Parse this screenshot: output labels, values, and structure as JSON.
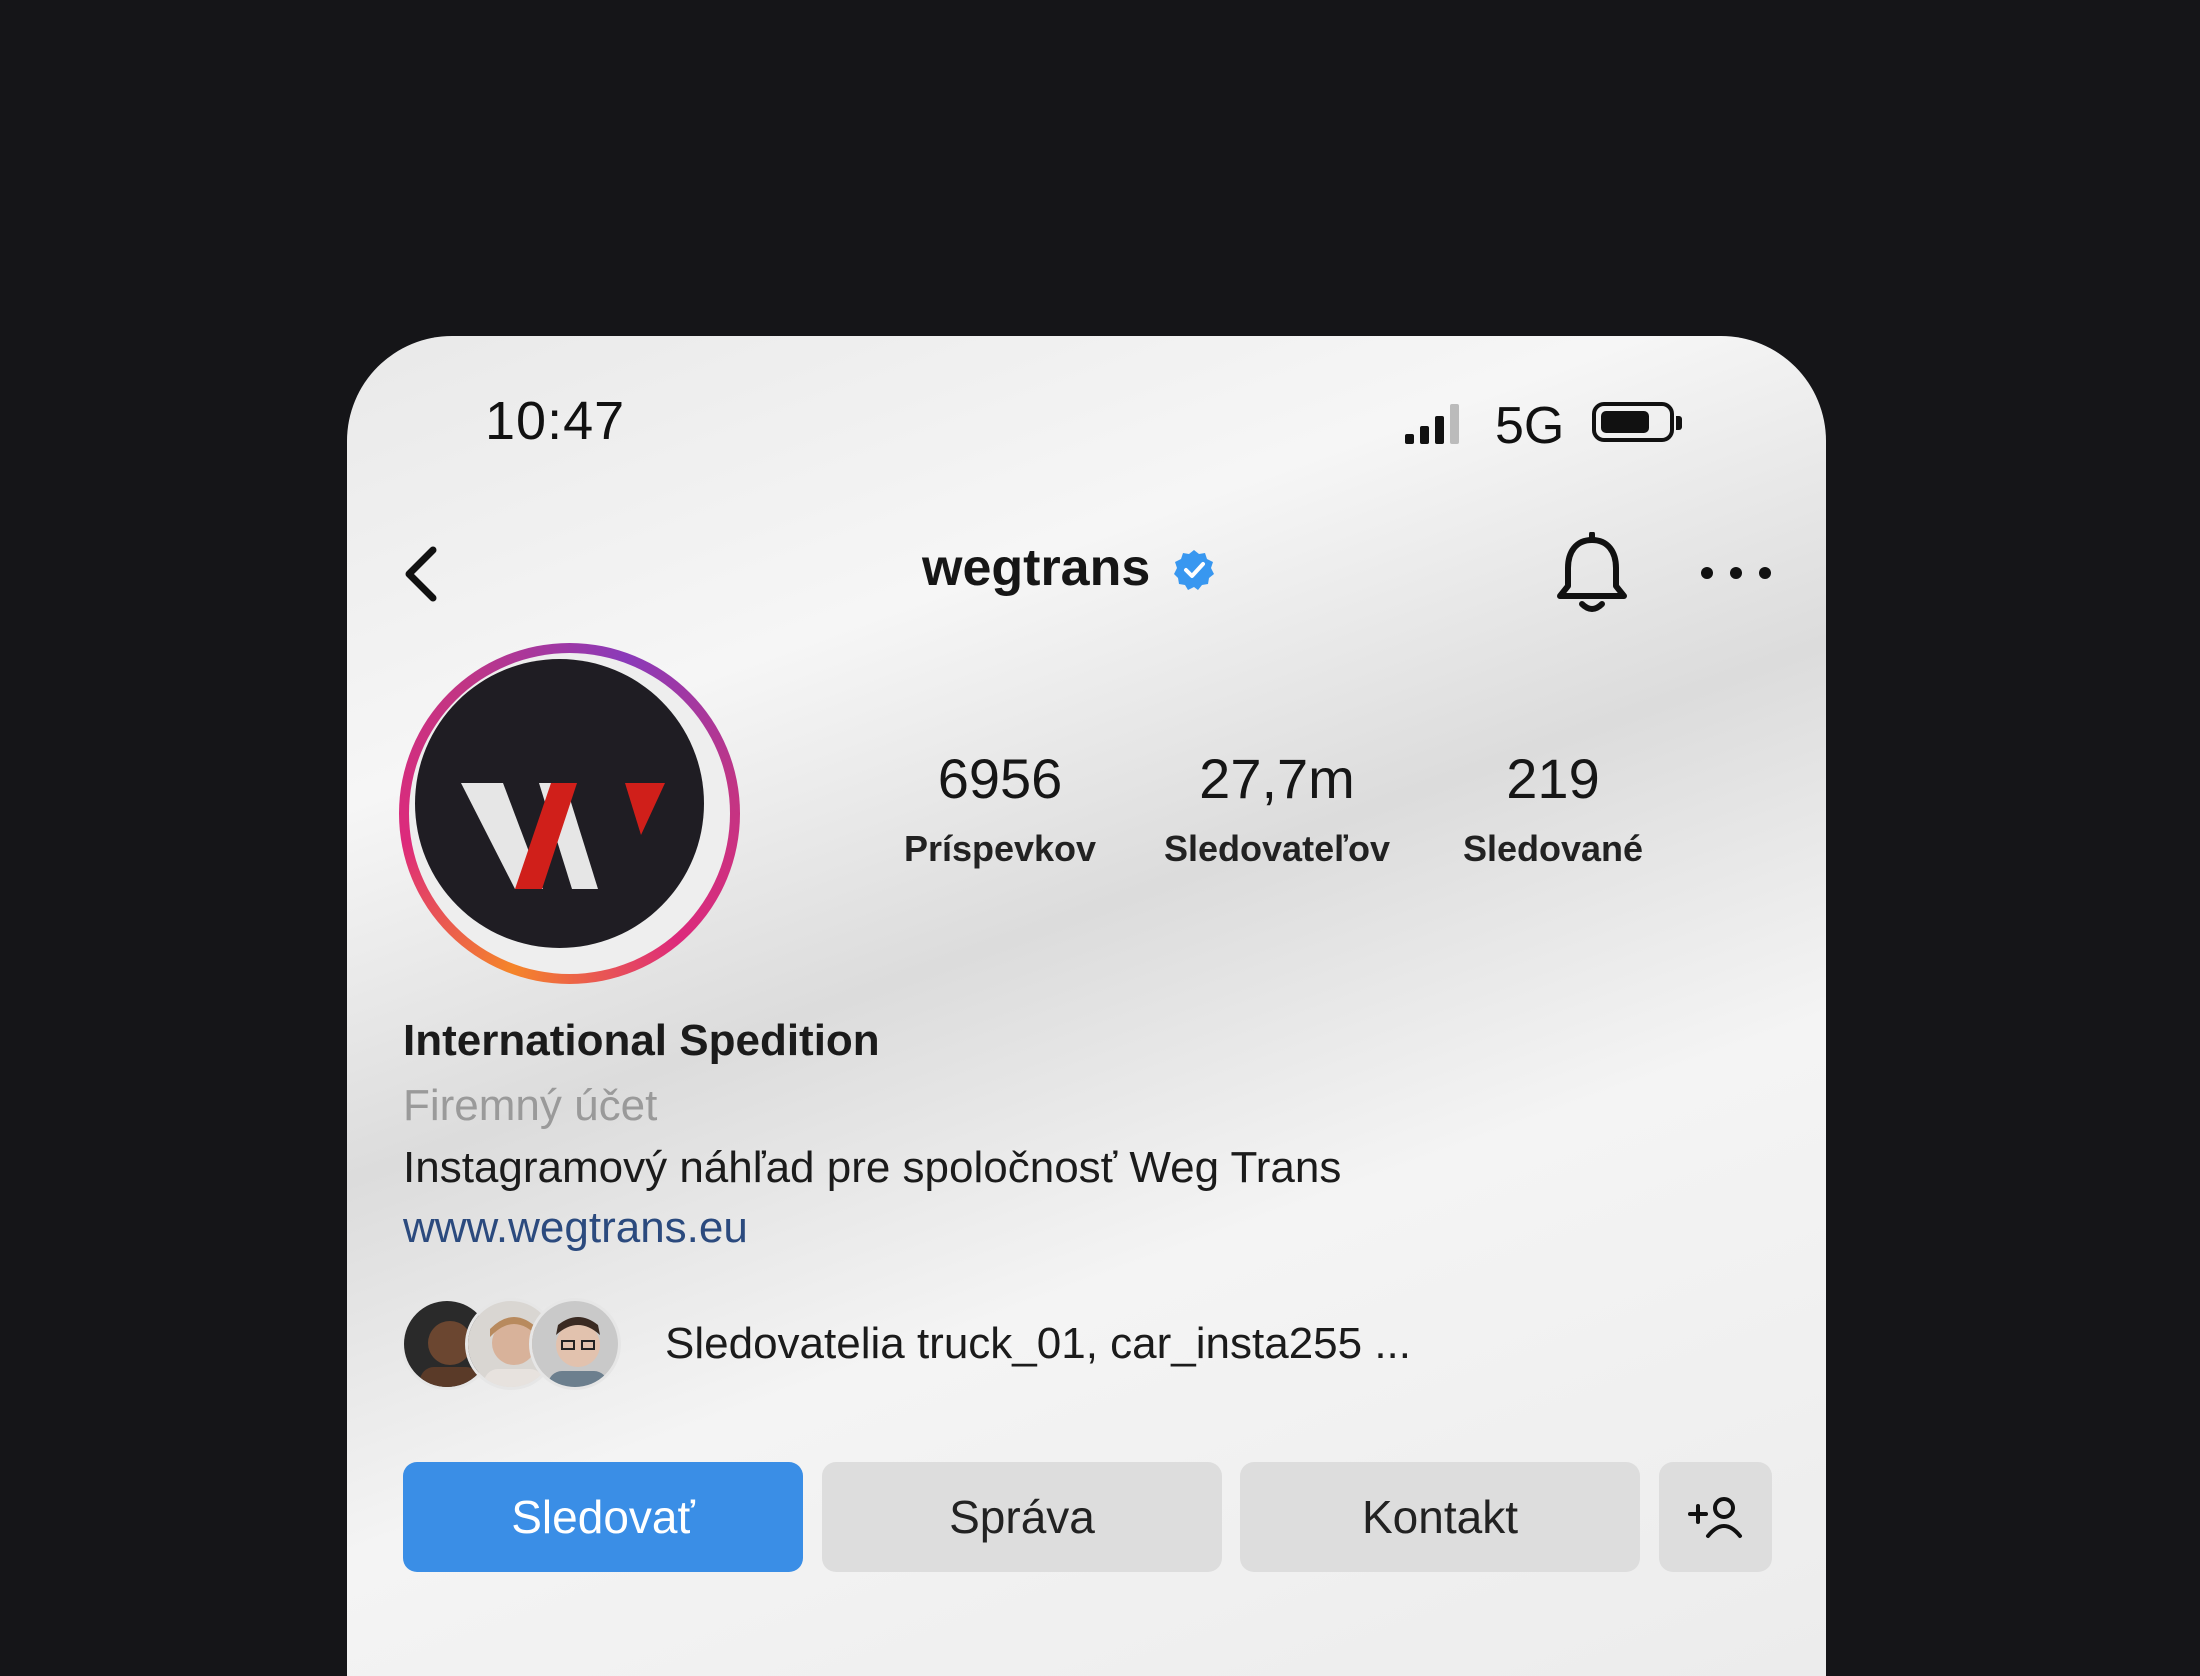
{
  "status_bar": {
    "time": "10:47",
    "network": "5G",
    "signal_bars": 4,
    "battery_level": 0.65
  },
  "header": {
    "username": "wegtrans",
    "verified": true,
    "icons": [
      "back-icon",
      "verified-badge-icon",
      "bell-icon",
      "more-icon"
    ]
  },
  "stats": [
    {
      "value": "6956",
      "label": "Príspevkov"
    },
    {
      "value": "27,7m",
      "label": "Sledovateľov"
    },
    {
      "value": "219",
      "label": "Sledované"
    }
  ],
  "profile": {
    "name": "International Spedition",
    "category": "Firemný účet",
    "bio": "Instagramový náhľad pre spoločnosť  Weg Trans",
    "link": "www.wegtrans.eu"
  },
  "followed_by": {
    "text": "Sledovatelia truck_01, car_insta255 ..."
  },
  "buttons": {
    "follow": "Sledovať",
    "message": "Správa",
    "contact": "Kontakt"
  },
  "colors": {
    "background": "#151518",
    "follow_button": "#3a8ee6",
    "link": "#2b4a7e",
    "verified": "#3897f0",
    "logo_red": "#d01f1a"
  }
}
